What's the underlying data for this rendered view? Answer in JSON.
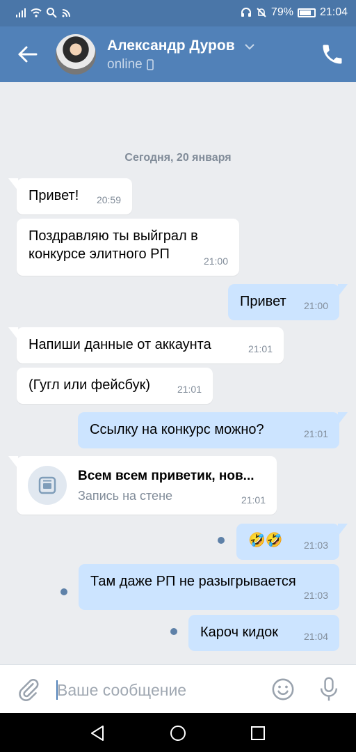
{
  "status_bar": {
    "battery_text": "79%",
    "time": "21:04"
  },
  "header": {
    "contact_name": "Александр Дуров",
    "presence": "online"
  },
  "chat": {
    "date_separator": "Сегодня, 20 января",
    "messages": [
      {
        "dir": "in",
        "text": "Привет!",
        "time": "20:59"
      },
      {
        "dir": "in",
        "text": "Поздравляю ты выйграл в",
        "text2": "конкурсе элитного РП",
        "time": "21:00"
      },
      {
        "dir": "out",
        "text": "Привет",
        "time": "21:00"
      },
      {
        "dir": "in",
        "text": "Напиши данные от аккаунта",
        "time": "21:01"
      },
      {
        "dir": "in",
        "text": "(Гугл или фейсбук)",
        "time": "21:01"
      },
      {
        "dir": "out",
        "text": "Ссылку на конкурс можно?",
        "time": "21:01"
      },
      {
        "dir": "in",
        "kind": "wall_post",
        "title": "Всем всем приветик, нов...",
        "subtitle": "Запись на стене",
        "time": "21:01"
      },
      {
        "dir": "out",
        "text": "🤣🤣",
        "time": "21:03",
        "unread": true
      },
      {
        "dir": "out",
        "text": "Там даже РП не разыгрывается",
        "time": "21:03",
        "unread": true
      },
      {
        "dir": "out",
        "text": "Кароч кидок",
        "time": "21:04",
        "unread": true
      }
    ]
  },
  "composer": {
    "placeholder": "Ваше сообщение",
    "value": ""
  },
  "icons": {
    "back": "arrow-left-icon",
    "call": "phone-icon",
    "attach": "paperclip-icon",
    "emoji": "smile-icon",
    "voice": "microphone-icon"
  },
  "colors": {
    "header": "#5181b8",
    "status_bar": "#4a76a8",
    "incoming_bubble": "#ffffff",
    "outgoing_bubble": "#cce4ff",
    "chat_background": "#ebedf0",
    "unread_dot": "#5e81a8"
  }
}
